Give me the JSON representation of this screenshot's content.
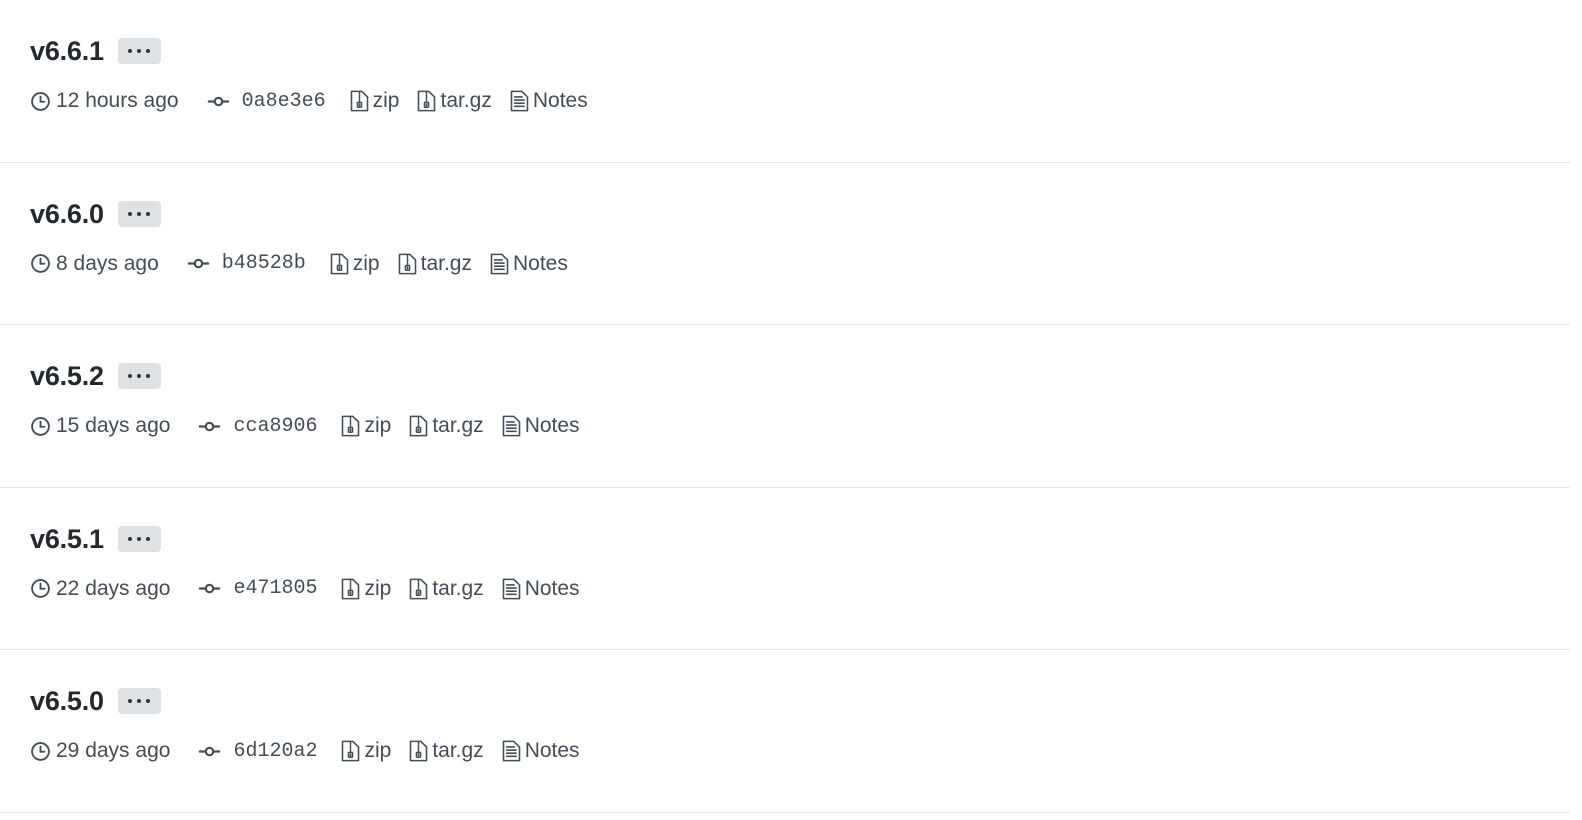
{
  "page": {
    "kind": "github-releases-tag-list",
    "colors": {
      "background": "#ffffff",
      "title": "#24292e",
      "meta_text": "#444d56",
      "divider": "#e1e4e8",
      "badge_bg": "#dfe2e5",
      "badge_dot": "#2f363d"
    }
  },
  "icons": {
    "clock": "clock-icon",
    "commit": "git-commit-icon",
    "zip": "file-zip-icon",
    "targz": "file-zip-icon",
    "notes": "file-text-icon",
    "more": "kebab-horizontal-icon"
  },
  "labels": {
    "zip": "zip",
    "targz": "tar.gz",
    "notes": "Notes",
    "more": "..."
  },
  "releases": [
    {
      "version": "v6.6.1",
      "time": "12 hours ago",
      "commit": "0a8e3e6",
      "zip": "zip",
      "targz": "tar.gz",
      "notes": "Notes"
    },
    {
      "version": "v6.6.0",
      "time": "8 days ago",
      "commit": "b48528b",
      "zip": "zip",
      "targz": "tar.gz",
      "notes": "Notes"
    },
    {
      "version": "v6.5.2",
      "time": "15 days ago",
      "commit": "cca8906",
      "zip": "zip",
      "targz": "tar.gz",
      "notes": "Notes"
    },
    {
      "version": "v6.5.1",
      "time": "22 days ago",
      "commit": "e471805",
      "zip": "zip",
      "targz": "tar.gz",
      "notes": "Notes"
    },
    {
      "version": "v6.5.0",
      "time": "29 days ago",
      "commit": "6d120a2",
      "zip": "zip",
      "targz": "tar.gz",
      "notes": "Notes"
    }
  ]
}
